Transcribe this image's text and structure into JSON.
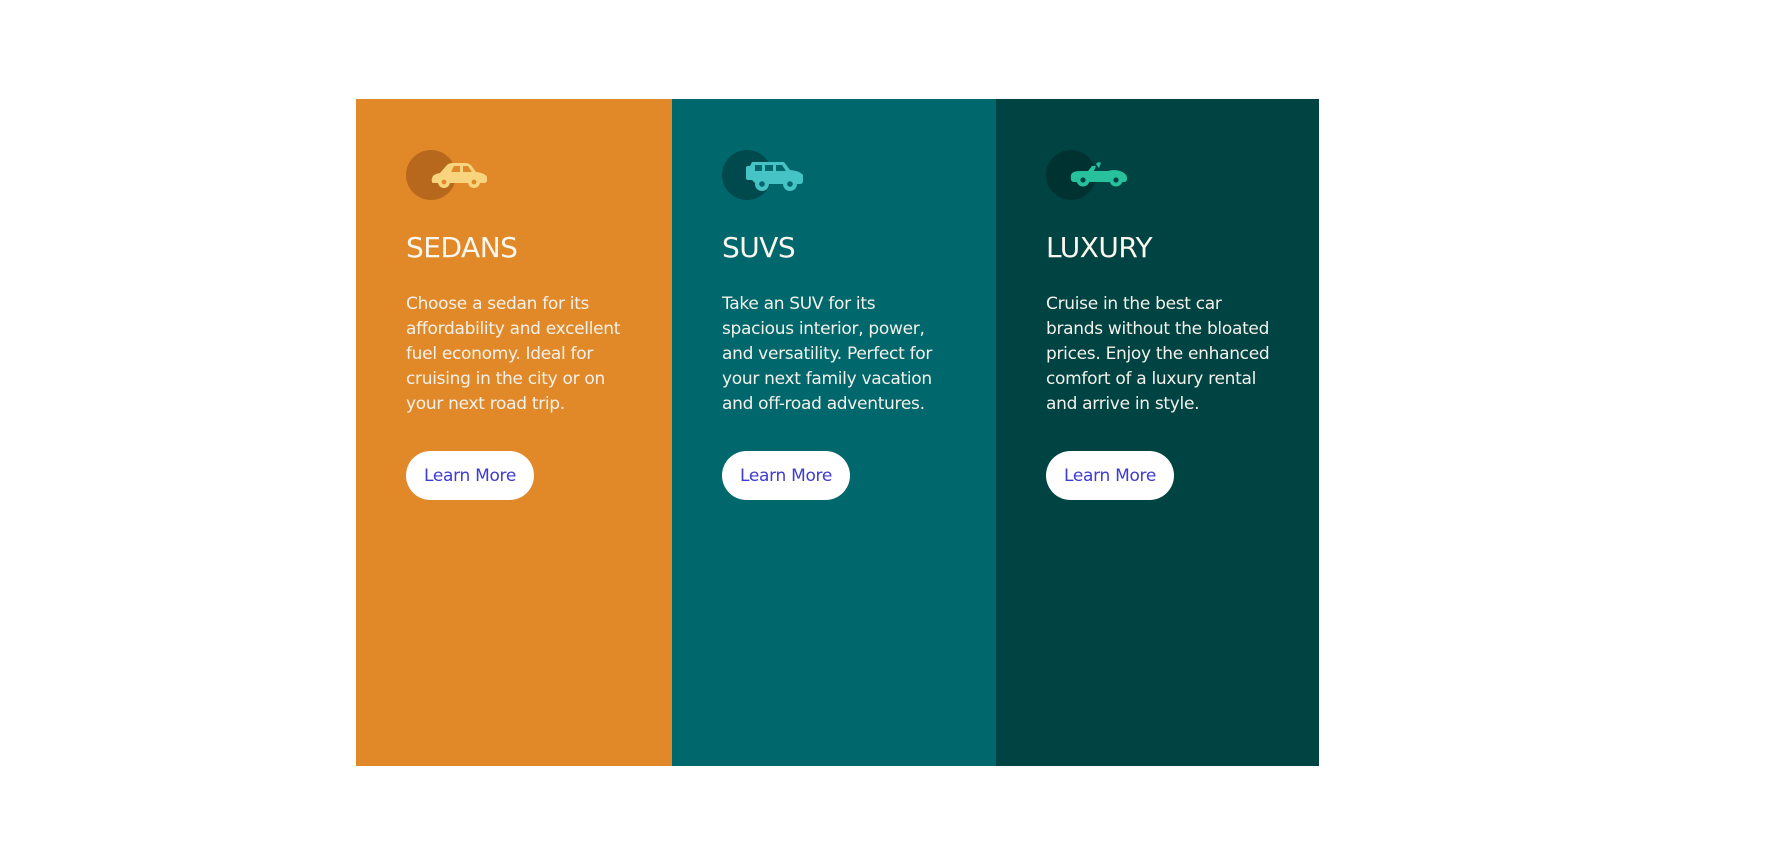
{
  "cards": [
    {
      "title": "SEDANS",
      "text": "Choose a sedan for its affordability and excellent fuel economy. Ideal for cruising in the city or on your next road trip.",
      "button_label": "Learn More",
      "icon": "sedan-car-icon",
      "background_color": "#e18929",
      "icon_color": "#f9d47f",
      "icon_circle_color": "#b8681c",
      "button_text_color": "#3d3bd1"
    },
    {
      "title": "SUVS",
      "text": "Take an SUV for its spacious interior, power, and versatility. Perfect for your next family vacation and off-road adventures.",
      "button_label": "Learn More",
      "icon": "suv-car-icon",
      "background_color": "#00686c",
      "icon_color": "#46c3c4",
      "icon_circle_color": "#00494d",
      "button_text_color": "#3d3bd1"
    },
    {
      "title": "LUXURY",
      "text": "Cruise in the best car brands without the bloated prices. Enjoy the enhanced comfort of a luxury rental and arrive in style.",
      "button_label": "Learn More",
      "icon": "convertible-car-icon",
      "background_color": "#004343",
      "icon_color": "#27c19d",
      "icon_circle_color": "#003232",
      "button_text_color": "#3d3bd1"
    }
  ]
}
